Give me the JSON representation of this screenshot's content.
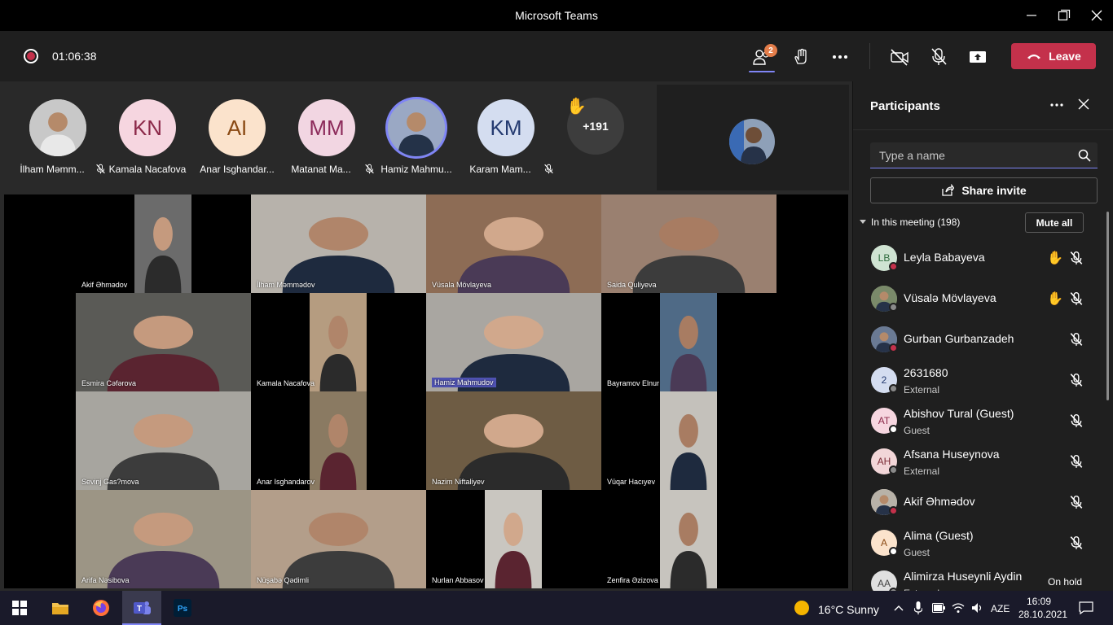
{
  "window": {
    "title": "Microsoft Teams"
  },
  "meeting": {
    "timer": "01:06:38",
    "participants_badge": "2",
    "leave_label": "Leave"
  },
  "strip": {
    "participants": [
      {
        "name": "İlham Məmm...",
        "initials": "",
        "bg": "#c8c8c8",
        "fg": "#333333",
        "muted": true
      },
      {
        "name": "Kamala Nacafova",
        "initials": "KN",
        "bg": "#f6d6e0",
        "fg": "#8c2a4a",
        "muted": false
      },
      {
        "name": "Anar Isghandar...",
        "initials": "AI",
        "bg": "#fbe3cc",
        "fg": "#8a4a14",
        "muted": false
      },
      {
        "name": "Matanat Ma...",
        "initials": "MM",
        "bg": "#f2d6e2",
        "fg": "#8c2a5a",
        "muted": true
      },
      {
        "name": "Hamiz Mahmu...",
        "initials": "",
        "bg": "#9aa8c4",
        "fg": "#333333",
        "muted": false
      },
      {
        "name": "Karam Mam...",
        "initials": "KM",
        "bg": "#d4ddf0",
        "fg": "#243a70",
        "muted": true
      }
    ],
    "overflow": "+191"
  },
  "video_tiles": [
    {
      "name": "Akif Əhmədov",
      "bg": "#6b6b6b"
    },
    {
      "name": "İlham Məmmədov",
      "bg": "#b7b2ab"
    },
    {
      "name": "Vüsala Mövlayeva",
      "bg": "#8d6c55"
    },
    {
      "name": "Saida Quliyeva",
      "bg": "#9a8070"
    },
    {
      "name": "Esmira Cəfərova",
      "bg": "#5a5a56"
    },
    {
      "name": "Kamala Nacafova",
      "bg": "#b59c80"
    },
    {
      "name": "Hamiz Mahmudov",
      "bg": "#a9a6a1"
    },
    {
      "name": "Bayramov Elnur",
      "bg": "#4f6a86"
    },
    {
      "name": "Sevinj Gas?mova",
      "bg": "#a7a59f"
    },
    {
      "name": "Anar Isghandarov",
      "bg": "#8a7a62"
    },
    {
      "name": "Nazim Niftaliyev",
      "bg": "#6e5c44"
    },
    {
      "name": "Vüqar Hacıyev",
      "bg": "#c4c1bb"
    },
    {
      "name": "Arifa Nəsibova",
      "bg": "#9c9585"
    },
    {
      "name": "Nüşabə Qədimli",
      "bg": "#b39e8a"
    },
    {
      "name": "Nurlan Abbasov",
      "bg": "#c9c6c0"
    },
    {
      "name": "Zenfira Əzizova",
      "bg": "#c7c4be"
    }
  ],
  "panel": {
    "title": "Participants",
    "search_placeholder": "Type a name",
    "share_invite": "Share invite",
    "in_meeting": "In this meeting (198)",
    "mute_all": "Mute all",
    "participants": [
      {
        "name": "Leyla Babayeva",
        "sub": "",
        "initials": "LB",
        "avatar_bg": "#cfe3d2",
        "avatar_fg": "#2e6b3d",
        "status_color": "#c4314b",
        "hand": true,
        "on_hold": ""
      },
      {
        "name": "Vüsalə Mövlayeva",
        "sub": "",
        "initials": "",
        "avatar_bg": "#7a8a6a",
        "avatar_fg": "#ffffff",
        "status_color": "#8a8a8a",
        "hand": true,
        "on_hold": ""
      },
      {
        "name": "Gurban Gurbanzadeh",
        "sub": "",
        "initials": "",
        "avatar_bg": "#6a7a94",
        "avatar_fg": "#ffffff",
        "status_color": "#c4314b",
        "hand": false,
        "on_hold": ""
      },
      {
        "name": "2631680",
        "sub": "External",
        "initials": "2",
        "avatar_bg": "#d4ddf0",
        "avatar_fg": "#243a70",
        "status_color": "#8a8a8a",
        "hand": false,
        "on_hold": ""
      },
      {
        "name": "Abishov Tural (Guest)",
        "sub": "Guest",
        "initials": "AT",
        "avatar_bg": "#f6d6e0",
        "avatar_fg": "#8c2a4a",
        "status_color": "#ffffff",
        "hand": false,
        "on_hold": ""
      },
      {
        "name": "Afsana Huseynova",
        "sub": "External",
        "initials": "AH",
        "avatar_bg": "#f2d6d8",
        "avatar_fg": "#7a2a34",
        "status_color": "#8a8a8a",
        "hand": false,
        "on_hold": ""
      },
      {
        "name": "Akif Əhmədov",
        "sub": "",
        "initials": "",
        "avatar_bg": "#b8b2a8",
        "avatar_fg": "#333333",
        "status_color": "#c4314b",
        "hand": false,
        "on_hold": ""
      },
      {
        "name": "Alima (Guest)",
        "sub": "Guest",
        "initials": "A",
        "avatar_bg": "#fbe3cc",
        "avatar_fg": "#8a4a14",
        "status_color": "#ffffff",
        "hand": false,
        "on_hold": ""
      },
      {
        "name": "Alimirza Huseynli Aydin",
        "sub": "External",
        "initials": "AA",
        "avatar_bg": "#e0e0e0",
        "avatar_fg": "#444444",
        "status_color": "#8a8a8a",
        "hand": false,
        "on_hold": "On hold"
      }
    ]
  },
  "taskbar": {
    "weather": "16°C  Sunny",
    "language": "AZE",
    "time": "16:09",
    "date": "28.10.2021"
  }
}
